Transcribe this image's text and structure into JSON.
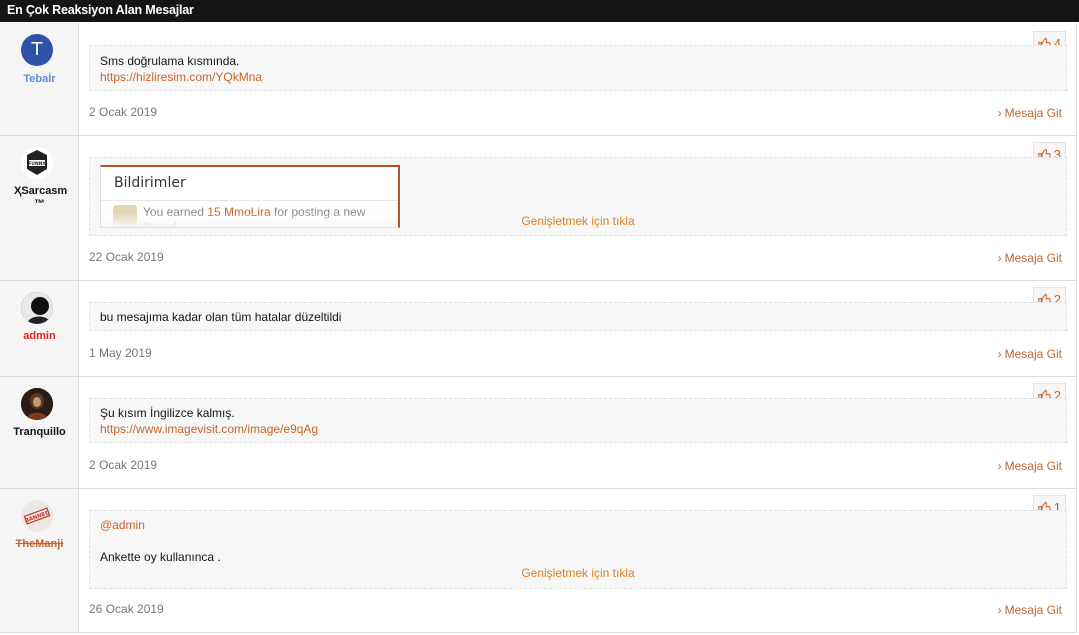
{
  "header": {
    "title": "En Çok Reaksiyon Alan Mesajlar"
  },
  "common": {
    "goto_label": "Mesaja Git",
    "expand_label": "Genişletmek için tıkla"
  },
  "posts": [
    {
      "user": "Tebaİr",
      "avatar_letter": "T",
      "reactions": "4",
      "lines": [
        "Sms doğrulama kısmında."
      ],
      "link": "https://hizliresim.com/YQkMna",
      "date": "2 Ocak 2019"
    },
    {
      "user": "ҲSarcasm ™",
      "reactions": "3",
      "notification": {
        "title": "Bildirimler",
        "text_before": "You earned ",
        "highlight": "15 MmoLira",
        "text_after": " for posting a new",
        "text_line2": "thread"
      },
      "date": "22 Ocak 2019"
    },
    {
      "user": "admin",
      "reactions": "2",
      "lines": [
        "bu mesajıma kadar olan tüm hatalar düzeltildi"
      ],
      "date": "1 May 2019"
    },
    {
      "user": "Tranquillo",
      "reactions": "2",
      "lines": [
        "Şu kısım İngilizce kalmış."
      ],
      "link": "https://www.imagevisit.com/image/e9qAg",
      "date": "2 Ocak 2019"
    },
    {
      "user": "TheManji",
      "reactions": "1",
      "mention": "@admin",
      "lines": [
        "Ankette oy kullanınca ."
      ],
      "date": "26 Ocak 2019"
    }
  ],
  "icons": {
    "reaction": "thumbs-up-icon",
    "goto": "chevron-right-icon"
  },
  "colors": {
    "accent": "#c8642a",
    "header_bg": "#151515",
    "expand": "#e07f1b",
    "admin": "#e0201b",
    "user_blue": "#5a8fd6"
  }
}
